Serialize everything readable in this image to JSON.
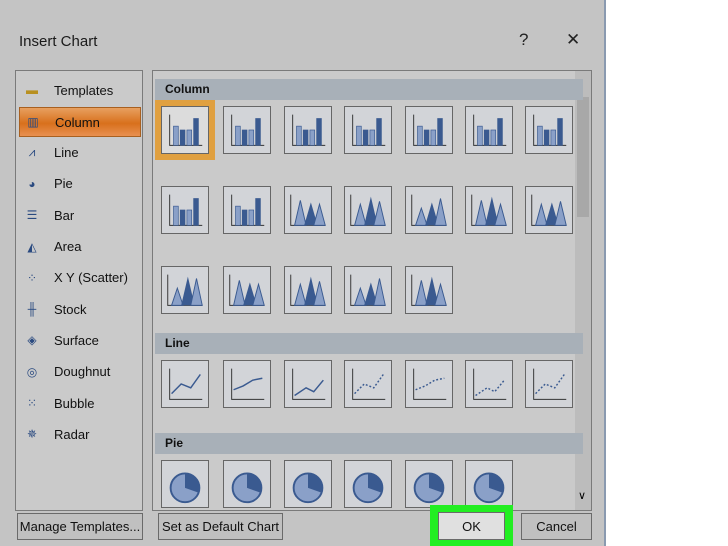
{
  "dialog": {
    "title": "Insert Chart",
    "help": "?",
    "close": "✕"
  },
  "sidebar": {
    "items": [
      {
        "label": "Templates",
        "icon": "folder-icon",
        "glyph": "▬"
      },
      {
        "label": "Column",
        "icon": "column-chart-icon",
        "glyph": "▥",
        "selected": true
      },
      {
        "label": "Line",
        "icon": "line-chart-icon",
        "glyph": "⩘"
      },
      {
        "label": "Pie",
        "icon": "pie-chart-icon",
        "glyph": "◕"
      },
      {
        "label": "Bar",
        "icon": "bar-chart-icon",
        "glyph": "☰"
      },
      {
        "label": "Area",
        "icon": "area-chart-icon",
        "glyph": "◭"
      },
      {
        "label": "X Y (Scatter)",
        "icon": "scatter-chart-icon",
        "glyph": "⁘"
      },
      {
        "label": "Stock",
        "icon": "stock-chart-icon",
        "glyph": "╫"
      },
      {
        "label": "Surface",
        "icon": "surface-chart-icon",
        "glyph": "◈"
      },
      {
        "label": "Doughnut",
        "icon": "doughnut-chart-icon",
        "glyph": "◎"
      },
      {
        "label": "Bubble",
        "icon": "bubble-chart-icon",
        "glyph": "⁙"
      },
      {
        "label": "Radar",
        "icon": "radar-chart-icon",
        "glyph": "✵"
      }
    ]
  },
  "sections": [
    {
      "label": "Column",
      "count": 19,
      "kind": "column"
    },
    {
      "label": "Line",
      "count": 7,
      "kind": "line"
    },
    {
      "label": "Pie",
      "count": 6,
      "kind": "pie"
    }
  ],
  "buttons": {
    "manage": "Manage Templates...",
    "set_default": "Set as Default Chart",
    "ok": "OK",
    "cancel": "Cancel"
  },
  "colors": {
    "highlight": "#22ee22",
    "selected": "#d8701c"
  }
}
